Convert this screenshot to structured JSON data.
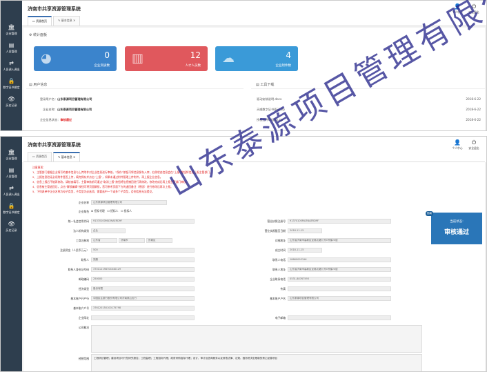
{
  "app": {
    "title": "济南市共享资源管理系统"
  },
  "sidebar": {
    "items": [
      {
        "label": "企业管理",
        "icon": "building-icon"
      },
      {
        "label": "人员管理",
        "icon": "user-card-icon"
      },
      {
        "label": "人员调入调出",
        "icon": "transfer-icon"
      },
      {
        "label": "数字证书绑定",
        "icon": "lock-icon"
      },
      {
        "label": "历史记录",
        "icon": "eye-icon"
      }
    ]
  },
  "header": {
    "user_center": "个人中心",
    "logout": "安全退出"
  },
  "tabs1": [
    {
      "label": "资源首页"
    },
    {
      "label": "基本信息"
    }
  ],
  "tabs2": [
    {
      "label": "资源首页"
    },
    {
      "label": "基本信息"
    }
  ],
  "stats_section": "统计面板",
  "stats": [
    {
      "value": "0",
      "label": "企业资质数"
    },
    {
      "value": "12",
      "label": "人才人员数"
    },
    {
      "value": "4",
      "label": "企业附件数"
    }
  ],
  "user_info": {
    "title": "用户信息",
    "rows": [
      {
        "k": "登录用户名：",
        "v": "山东泰源项目管理有限公司"
      },
      {
        "k": "企业名称：",
        "v": "山东泰源项目管理有限公司"
      },
      {
        "k": "企业信息状态：",
        "v": "审核通过"
      }
    ]
  },
  "downloads": {
    "title": "工具下载",
    "rows": [
      {
        "name": "驱动安装说明.docx",
        "date": "2018-6-22"
      },
      {
        "name": "天威数字证书驱动.zip",
        "date": "2018-6-22"
      },
      {
        "name": "授权控件CA驱动.zip",
        "date": "2018-6-22"
      }
    ]
  },
  "notice": {
    "lines": [
      "注意事项：",
      "1、主管部门根据企业填写的基本信息与上传附件对企业信息进行审核。“保存”按钮可将信息保存入库，右侧状态信息会在“上报”按钮将信息上报主管部门。",
      "2、上报信息验证必须附件是否上传，填完保存并点击“上报”，如果未通过附件管理上传附件，再上报企业信息。",
      "3、信息上报后不能再修改，请核查填写，主管审核前可通过“取消上报”按钮将信息撤回进行再修改，修改完成后再上报主管部门审核。",
      "4、信息被主管退回后，点击“解锁编辑”按钮可将页面解锁，您可参考页面下方的退回备注（原因）进行修改后再次上报。",
      "5、下列表单中企业名称为母子类型，子类型为必选项，需要选中一个或多个子类型，否则信息无法提交。"
    ]
  },
  "status": {
    "badge": "指南",
    "label": "当前状态:",
    "value": "审核通过"
  },
  "form": {
    "company_label": "企业名称",
    "company_value": "山东泰源项目管理有限公司",
    "role_label": "企业角色",
    "roles": [
      "招标代理",
      "招标人",
      "投标人"
    ],
    "uscc_label": "统一社会信用代码",
    "uscc_value": "91370100MA3NAERD9F",
    "license_label": "营业执照注册号",
    "license_value": "91370100MA3NAERD9F",
    "type_label": "法人机构类别",
    "type_value": "企业",
    "expire_label": "营业执照截至日期",
    "expire_value": "2018-11-15",
    "reg_label": "工商注册地",
    "reg_value1": "山东省",
    "reg_value2": "济南市",
    "reg_value3": "历城区",
    "addr_label": "详细地址",
    "addr_value": "山东省济南市高新区龙奥北路九号4号楼20层",
    "capital_label": "注册资金（人民币万元）",
    "capital_value": "500",
    "founded_label": "成立时间",
    "founded_value": "2018-11-15",
    "contact_label": "联系人",
    "contact_value": "张鹏",
    "phone_label": "联系人电话",
    "phone_value": "18660093196",
    "id_label": "联系人身份证号码",
    "id_value": "370112198704040129",
    "contact_addr_label": "联系人地址",
    "contact_addr_value": "山东省济南市高新区龙奥北路九号4号楼20层",
    "zip_label": "邮政编码",
    "zip_value": "250000",
    "tel_label": "企业联系电话",
    "tel_value": "0531-88767593",
    "econ_label": "经济类型",
    "econ_value": "股份有限",
    "fax_label": "传真",
    "fax_value": "",
    "bank_label": "基本账户开户行",
    "bank_value": "中国民生银行股份有限公司济南燕山支行",
    "bank_name_label": "基本账户户名",
    "bank_name_value": "山东泰源项目管理有限公司",
    "acct_label": "基本账户户号",
    "acct_value": "376120150100175798",
    "web_label": "企业网址",
    "web_value": "",
    "email_label": "电子邮箱",
    "email_value": "",
    "intro_label": "公司概况",
    "intro_value": "",
    "scope_label": "经营范围",
    "scope_value": "工程项目管理；建设项目可行性研究报告；工程监理；工程招标代理；政府采购招标代理；设计、审计及咨询服务以及其他法律、法规、国务院决定限制的禁止经营项目"
  },
  "watermark": "山东泰源项目管理有限公司"
}
